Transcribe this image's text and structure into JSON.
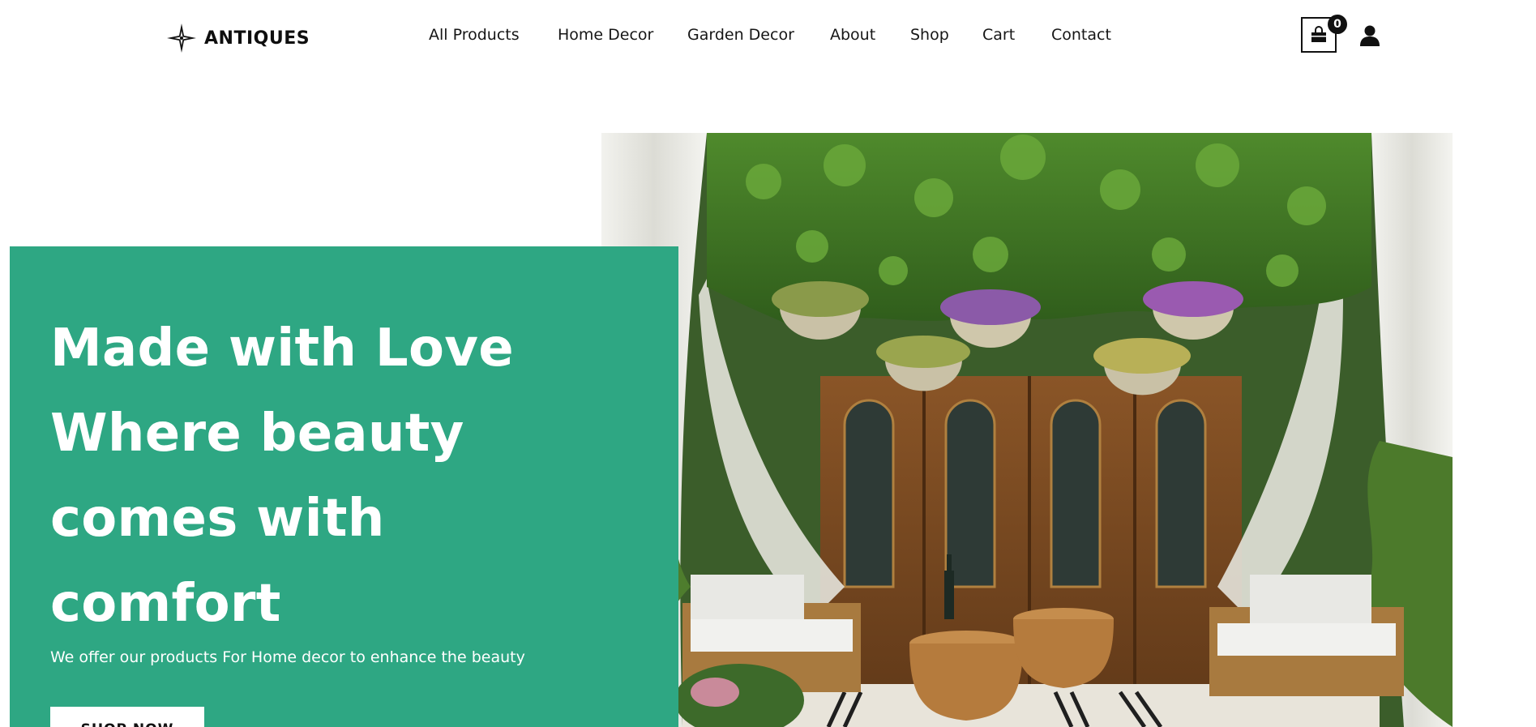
{
  "brand": {
    "name": "ANTIQUES",
    "logo_icon": "four-point-star-icon"
  },
  "nav": {
    "items": [
      {
        "label": "All Products"
      },
      {
        "label": "Home Decor"
      },
      {
        "label": "Garden Decor"
      },
      {
        "label": "About"
      },
      {
        "label": "Shop"
      },
      {
        "label": "Cart"
      },
      {
        "label": "Contact"
      }
    ]
  },
  "cart": {
    "count": "0",
    "icon": "shopping-bag-icon"
  },
  "account": {
    "icon": "user-icon"
  },
  "hero": {
    "title_lines": [
      "Made with Love",
      "Where beauty",
      "comes with",
      "comfort"
    ],
    "subtitle": "We offer our products For Home decor  to enhance the beauty",
    "cta_label": "SHOP NOW",
    "image": "patio-garden-photo",
    "accent_color": "#2ea783"
  }
}
